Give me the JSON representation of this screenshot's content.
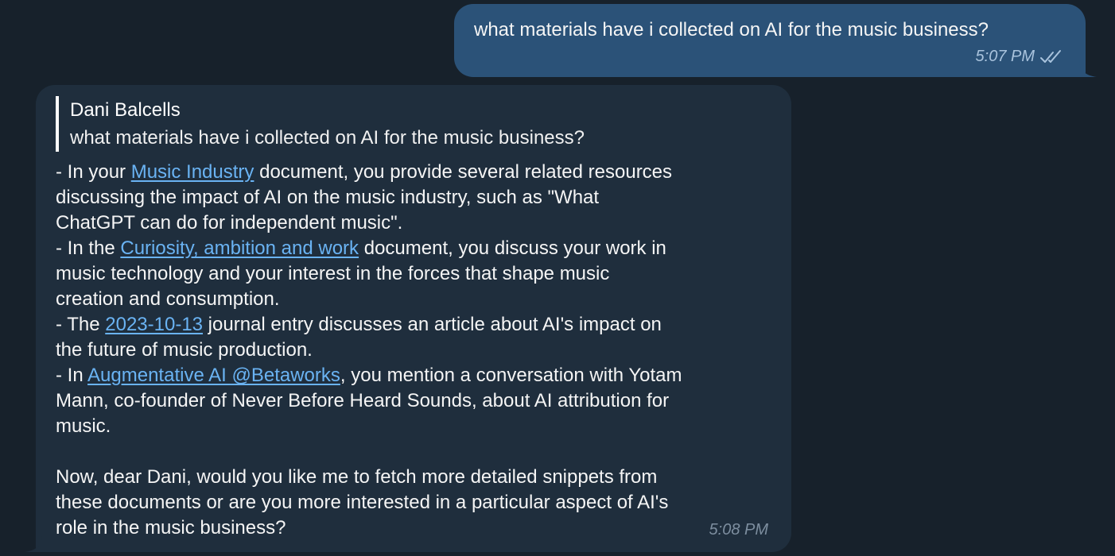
{
  "colors": {
    "background": "#17212b",
    "outgoing_bubble": "#2b5278",
    "incoming_bubble": "#1f2e3d",
    "link": "#6ab3f3"
  },
  "outgoing": {
    "text": "what materials have i collected on AI for the music business?",
    "time": "5:07 PM",
    "status_icon": "double-check-icon"
  },
  "incoming": {
    "reply": {
      "author": "Dani Balcells",
      "text": "what materials have i collected on AI for the music business?"
    },
    "lines": {
      "l1_pre": "- In your ",
      "l1_link": "Music Industry",
      "l1_post": " document, you provide several related resources",
      "l2": "discussing the impact of AI on the music industry, such as \"What",
      "l3": "ChatGPT can do for independent music\".",
      "l4_pre": "- In the ",
      "l4_link": "Curiosity, ambition and work",
      "l4_post": " document, you discuss your work in",
      "l5": "music technology and your interest in the forces that shape music",
      "l6": "creation and consumption.",
      "l7_pre": "- The ",
      "l7_link": "2023-10-13",
      "l7_post": " journal entry discusses an article about AI's impact on",
      "l8": "the future of music production.",
      "l9_pre": "- In ",
      "l9_link": "Augmentative AI @Betaworks",
      "l9_post": ", you mention a conversation with Yotam",
      "l10": "Mann, co-founder of Never Before Heard Sounds, about AI attribution for",
      "l11": "music.",
      "l12": "Now, dear Dani, would you like me to fetch more detailed snippets from",
      "l13": "these documents or are you more interested in a particular aspect of AI's",
      "l14": "role in the music business?"
    },
    "time": "5:08 PM"
  }
}
